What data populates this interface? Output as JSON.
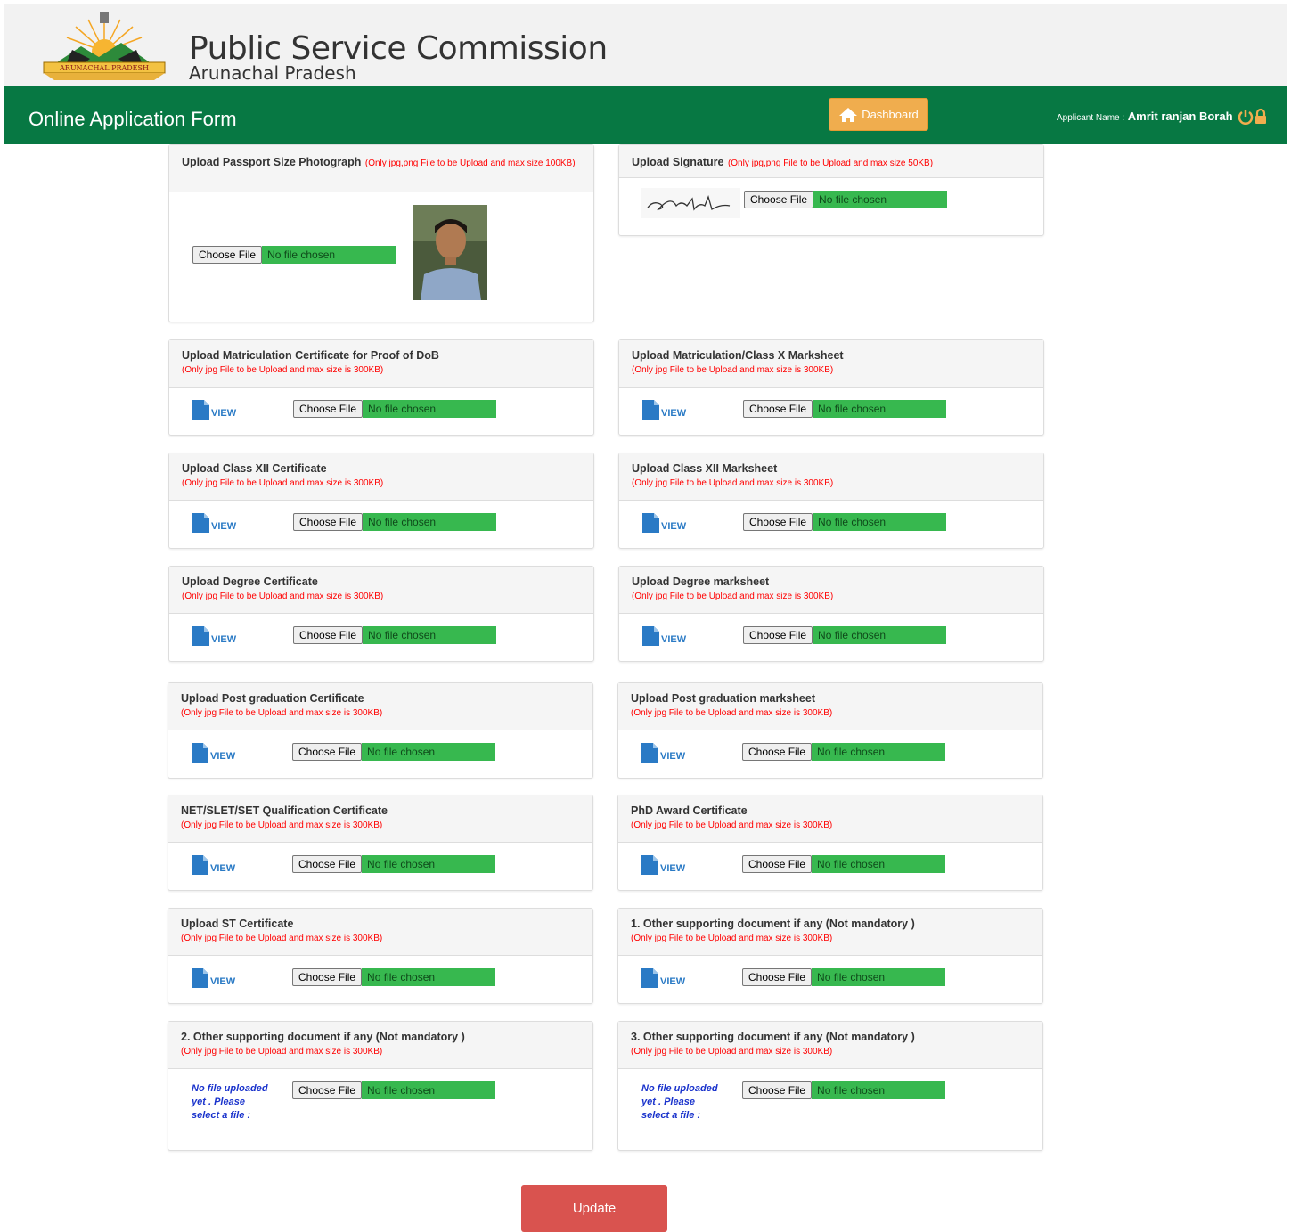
{
  "header": {
    "emblem_label": "ARUNACHAL PRADESH",
    "title": "Public Service Commission",
    "subtitle": "Arunachal Pradesh"
  },
  "navbar": {
    "form_title": "Online Application Form",
    "dashboard_label": "Dashboard",
    "applicant_label": "Applicant Name :",
    "applicant_name": "Amrit ranjan Borah"
  },
  "file_input": {
    "button": "Choose File",
    "status": "No file chosen"
  },
  "view_label": "VIEW",
  "no_file_text": "No file uploaded yet . Please select a file :",
  "photo_panel": {
    "title": "Upload Passport Size Photograph",
    "note": "(Only jpg,png File to be Upload and max size 100KB)"
  },
  "signature_panel": {
    "title": "Upload Signature",
    "note": "(Only jpg,png File to be Upload and max size 50KB)"
  },
  "doc_panels": [
    {
      "title": "Upload Matriculation Certificate for Proof of DoB",
      "note": "(Only jpg File to be Upload and max size is 300KB)"
    },
    {
      "title": "Upload Matriculation/Class X Marksheet",
      "note": "(Only jpg File to be Upload and max size is 300KB)"
    },
    {
      "title": "Upload Class XII Certificate",
      "note": "(Only jpg File to be Upload and max size is 300KB)"
    },
    {
      "title": "Upload Class XII Marksheet",
      "note": "(Only jpg File to be Upload and max size is 300KB)"
    },
    {
      "title": "Upload Degree Certificate",
      "note": "(Only jpg File to be Upload and max size is 300KB)"
    },
    {
      "title": "Upload Degree marksheet",
      "note": "(Only jpg File to be Upload and max size is 300KB)"
    },
    {
      "title": "Upload Post graduation Certificate",
      "note": "(Only jpg File to be Upload and max size is 300KB)"
    },
    {
      "title": "Upload Post graduation marksheet",
      "note": "(Only jpg File to be Upload and max size is 300KB)"
    },
    {
      "title": "NET/SLET/SET Qualification Certificate",
      "note": "(Only jpg File to be Upload and max size is 300KB)"
    },
    {
      "title": "PhD Award Certificate",
      "note": "(Only jpg File to be Upload and max size is 300KB)"
    },
    {
      "title": "Upload ST Certificate",
      "note": "(Only jpg File to be Upload and max size is 300KB)"
    },
    {
      "title": "1. Other supporting document if any (Not mandatory )",
      "note": "(Only jpg File to be Upload and max size is 300KB)"
    },
    {
      "title": "2. Other supporting document if any (Not mandatory )",
      "note": "(Only jpg File to be Upload and max size is 300KB)"
    },
    {
      "title": "3. Other supporting document if any (Not mandatory )",
      "note": "(Only jpg File to be Upload and max size is 300KB)"
    }
  ],
  "update_label": "Update",
  "colors": {
    "header_green": "#077843",
    "dashboard_orange": "#f0ad4e",
    "update_red": "#d9534f",
    "file_status_green": "#37b84f",
    "note_red": "#ff0000",
    "view_blue": "#2a7ac5"
  }
}
